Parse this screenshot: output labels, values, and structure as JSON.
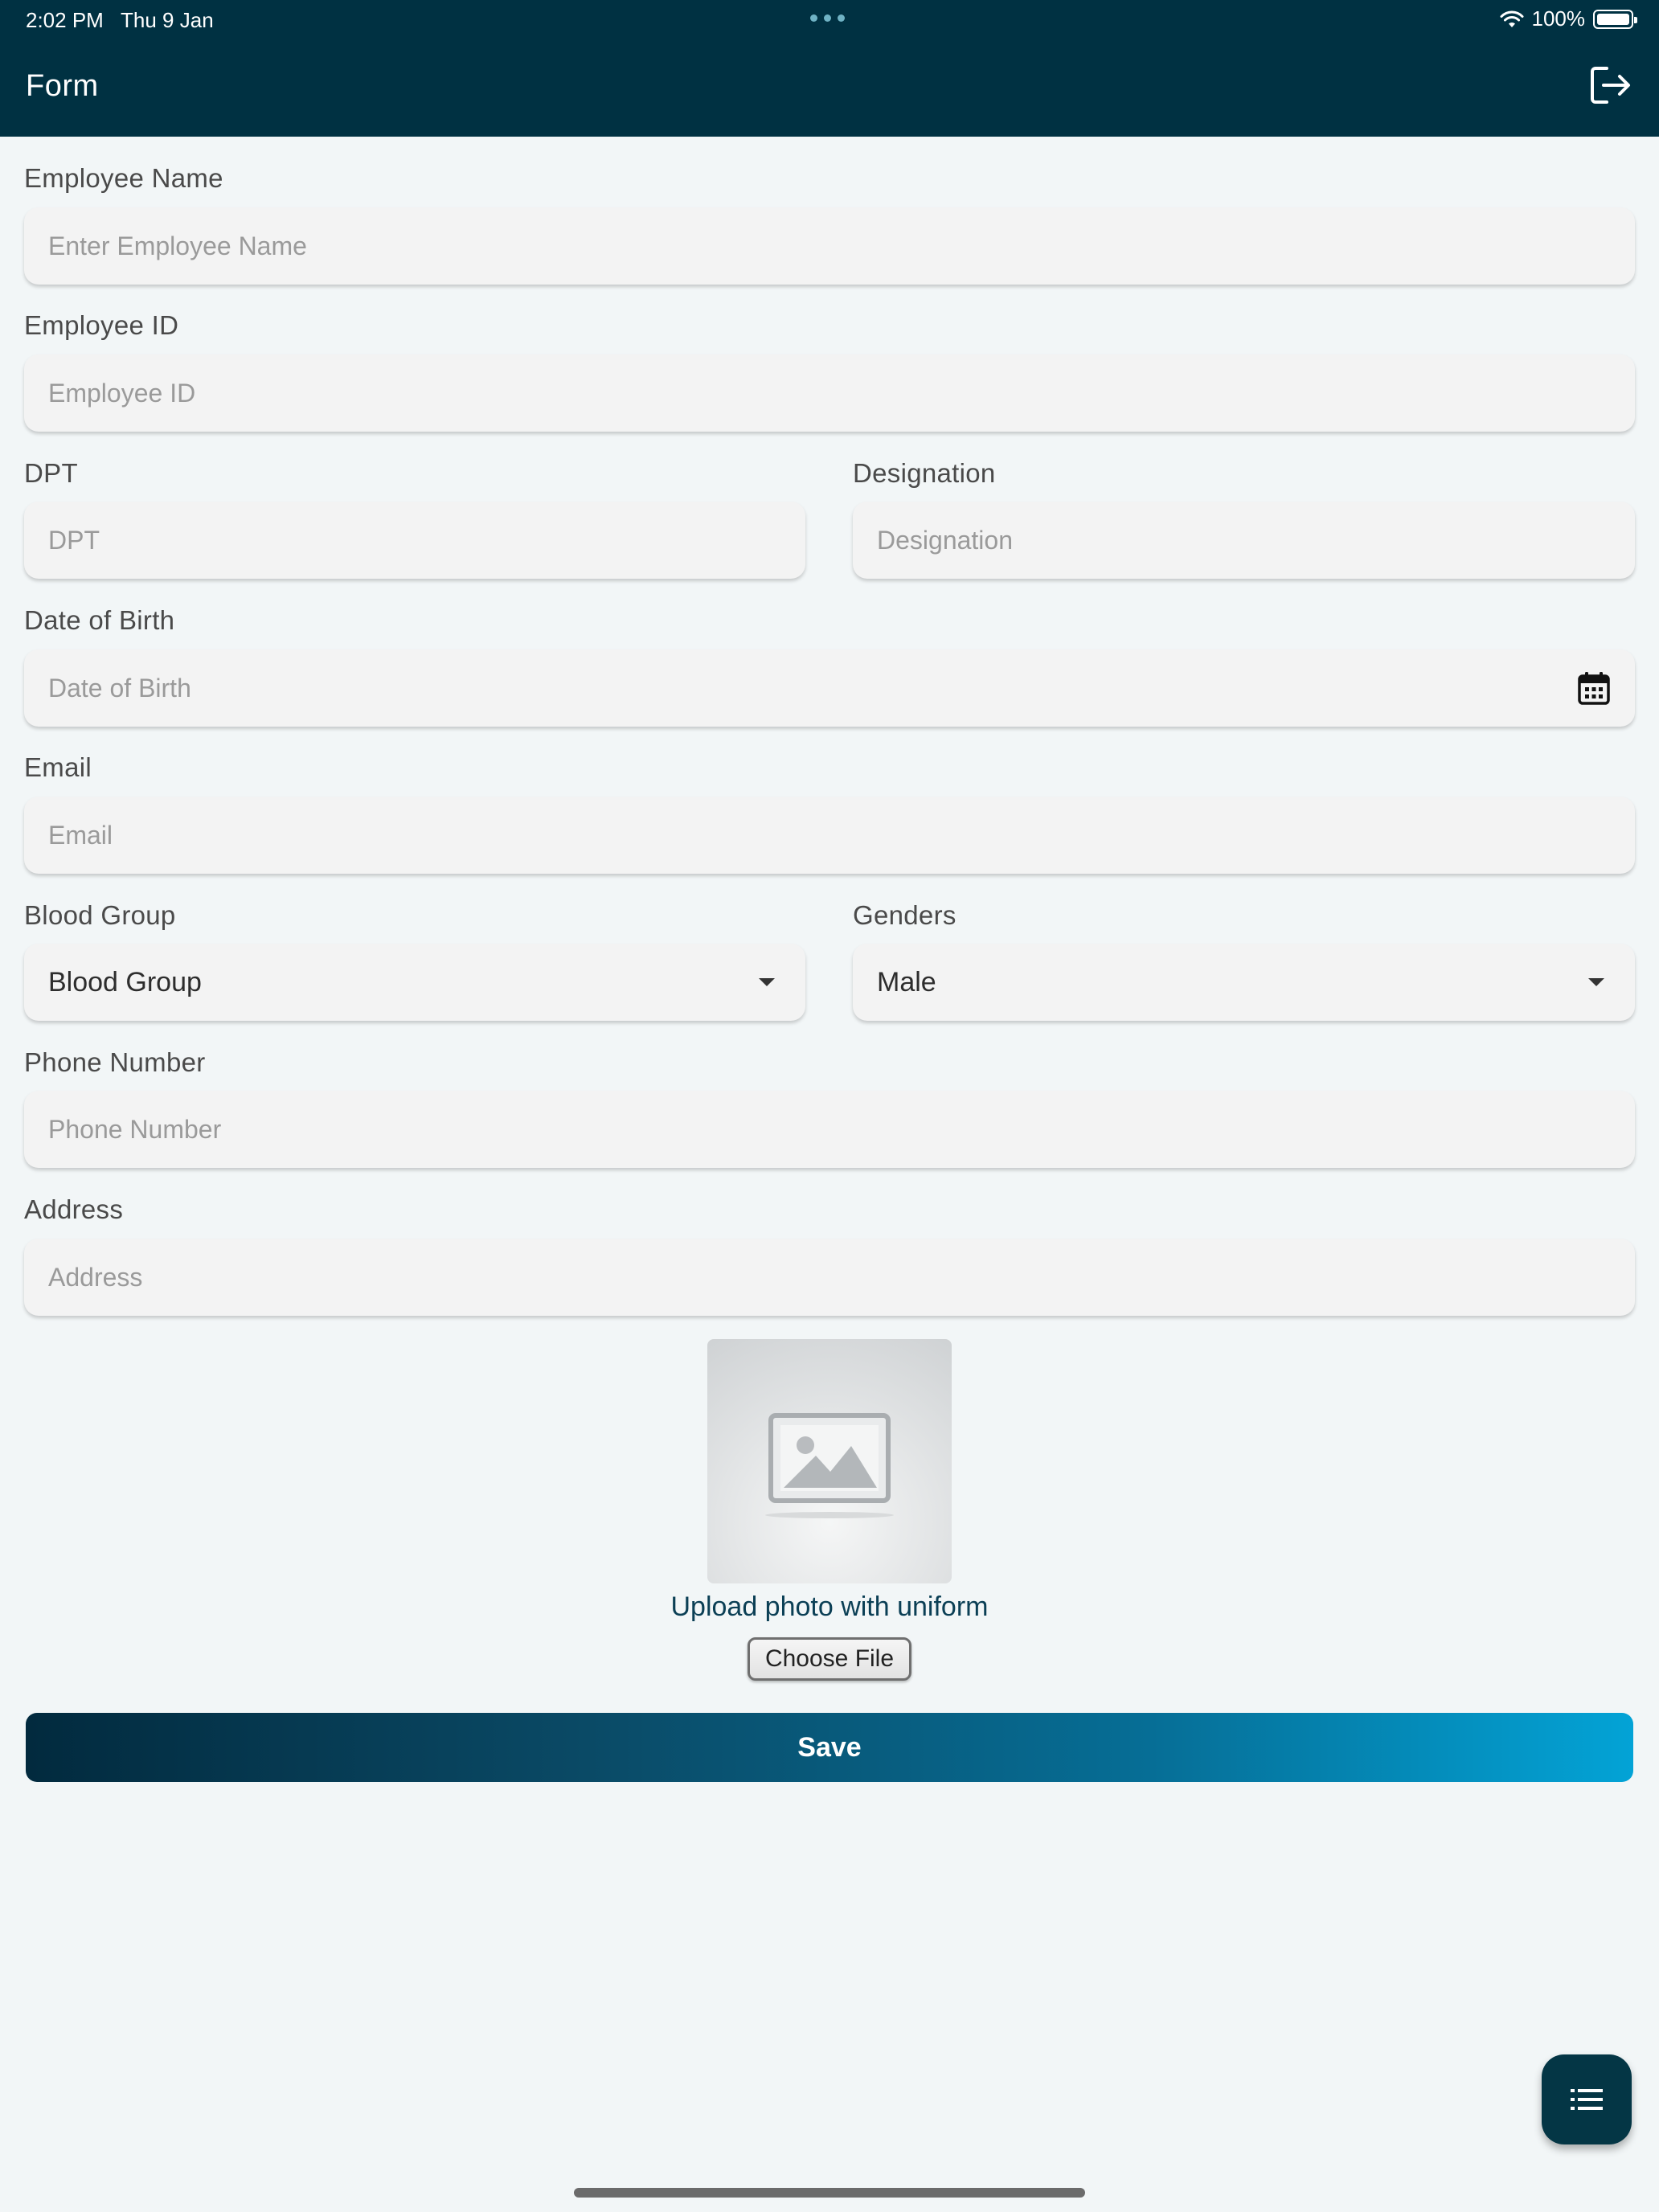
{
  "status_bar": {
    "time": "2:02 PM",
    "date": "Thu 9 Jan",
    "battery": "100%"
  },
  "appbar": {
    "title": "Form",
    "logout_icon": "logout-icon"
  },
  "form": {
    "employee_name": {
      "label": "Employee Name",
      "placeholder": "Enter Employee Name"
    },
    "employee_id": {
      "label": "Employee ID",
      "placeholder": "Employee ID"
    },
    "dpt": {
      "label": "DPT",
      "placeholder": "DPT"
    },
    "designation": {
      "label": "Designation",
      "placeholder": "Designation"
    },
    "dob": {
      "label": "Date of Birth",
      "placeholder": "Date of Birth",
      "icon": "calendar-icon"
    },
    "email": {
      "label": "Email",
      "placeholder": "Email"
    },
    "blood_group": {
      "label": "Blood Group",
      "value": "Blood Group"
    },
    "gender": {
      "label": "Genders",
      "value": "Male"
    },
    "phone": {
      "label": "Phone Number",
      "placeholder": "Phone Number"
    },
    "address": {
      "label": "Address",
      "placeholder": "Address"
    }
  },
  "upload": {
    "caption": "Upload photo with uniform",
    "button_label": "Choose File",
    "placeholder_icon": "image-placeholder-icon"
  },
  "save_label": "Save",
  "fab_icon": "list-icon",
  "colors": {
    "appbar": "#003142",
    "background": "#f2f6f7",
    "field": "#f3f3f3",
    "save_gradient_start": "#022a3e",
    "save_gradient_end": "#03a3d6",
    "fab": "#043645"
  }
}
